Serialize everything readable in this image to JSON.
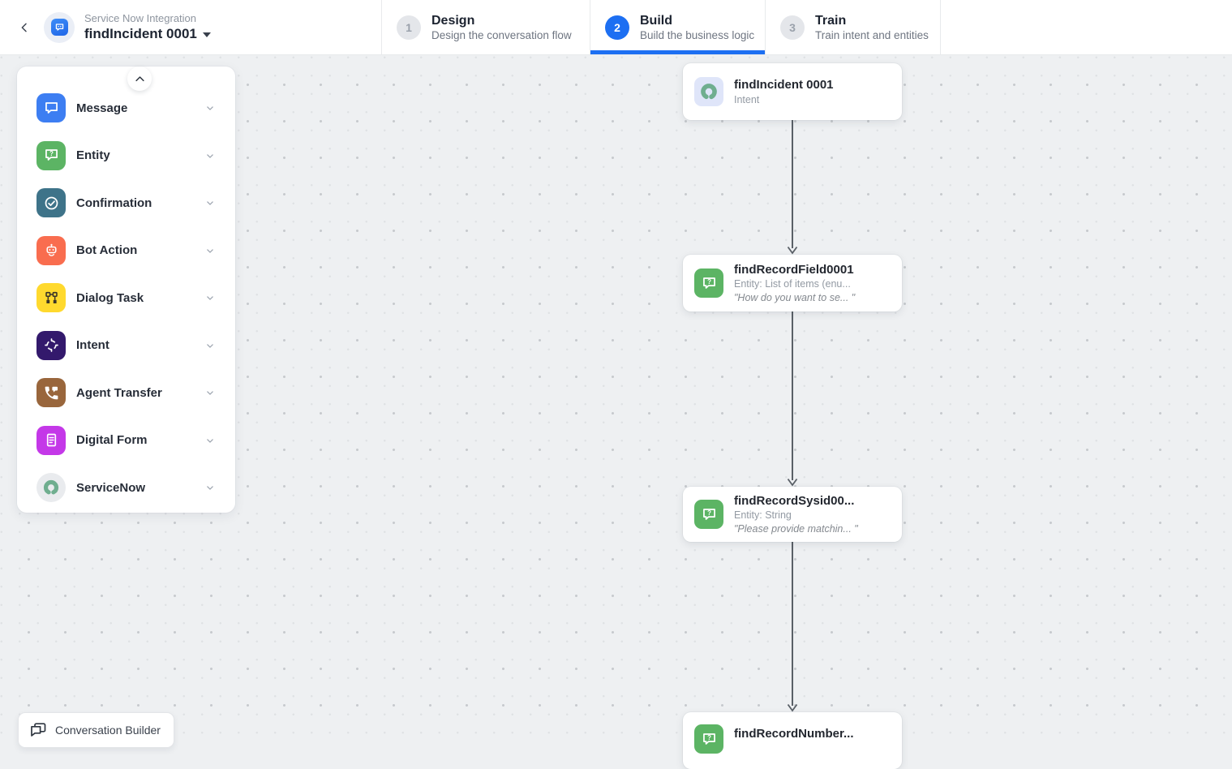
{
  "header": {
    "app_label": "Service Now Integration",
    "task_name": "findIncident 0001",
    "steps": [
      {
        "num": "1",
        "title": "Design",
        "subtitle": "Design the conversation flow",
        "active": false
      },
      {
        "num": "2",
        "title": "Build",
        "subtitle": "Build the business logic",
        "active": true
      },
      {
        "num": "3",
        "title": "Train",
        "subtitle": "Train intent and entities",
        "active": false
      }
    ]
  },
  "palette": {
    "items": [
      {
        "label": "Message",
        "icon": "message-icon",
        "color": "#3d7ef2"
      },
      {
        "label": "Entity",
        "icon": "entity-icon",
        "color": "#5cb464"
      },
      {
        "label": "Confirmation",
        "icon": "confirmation-icon",
        "color": "#3e7389"
      },
      {
        "label": "Bot Action",
        "icon": "bot-action-icon",
        "color": "#f96d4f"
      },
      {
        "label": "Dialog Task",
        "icon": "dialog-task-icon",
        "color": "#ffd92e"
      },
      {
        "label": "Intent",
        "icon": "intent-icon",
        "color": "#33196c"
      },
      {
        "label": "Agent Transfer",
        "icon": "agent-transfer-icon",
        "color": "#99663c"
      },
      {
        "label": "Digital Form",
        "icon": "digital-form-icon",
        "color": "#c438e8"
      },
      {
        "label": "ServiceNow",
        "icon": "servicenow-icon",
        "color": "#e9ebee"
      }
    ]
  },
  "canvas": {
    "nodes": [
      {
        "title": "findIncident 0001",
        "subtitle": "Intent",
        "quote": ""
      },
      {
        "title": "findRecordField0001",
        "subtitle": "Entity: List of items (enu...",
        "quote": "\"How do you want to se... \""
      },
      {
        "title": "findRecordSysid00...",
        "subtitle": "Entity: String",
        "quote": "\"Please provide matchin... \""
      },
      {
        "title": "findRecordNumber...",
        "subtitle": "",
        "quote": ""
      }
    ]
  },
  "footer": {
    "badge_label": "Conversation Builder"
  },
  "colors": {
    "accent_blue": "#1d6ff2",
    "servicenow_green": "#6fae8f",
    "canvas_bg": "#eef0f2",
    "connector": "#5a6067",
    "intent_node_icon_bg": "#dfe5f9"
  },
  "icons": {
    "back": "chevron-left",
    "task_dropdown": "caret-down",
    "palette_row": "chevron-down",
    "palette_collapse": "chevron-up",
    "footer_badge": "chat-bubbles"
  }
}
